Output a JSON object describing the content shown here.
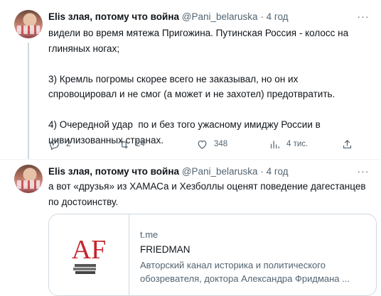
{
  "tweets": [
    {
      "author_name": "Elis злая, потому что война",
      "handle": "@Pani_belaruska",
      "separator": "·",
      "time": "4 год",
      "text": [
        "видели во время мятежа Пригожина. Путинская Россия - колосс на глиняных ногах;",
        "",
        "3) Кремль погромы скорее всего не заказывал, но он их спровоцировал и не смог (а может и не захотел) предотвратить.",
        "",
        "4) Очередной удар  по и без того ужасному имиджу России в цивилизованных странах."
      ],
      "actions": {
        "replies": "2",
        "retweets": "24",
        "likes": "348",
        "views": "4 тис."
      }
    },
    {
      "author_name": "Elis злая, потому что война",
      "handle": "@Pani_belaruska",
      "separator": "·",
      "time": "4 год",
      "text": [
        "а вот «друзья» из ХАМАСа и Хезболлы оценят поведение дагестанцев по достоинству."
      ],
      "card": {
        "domain": "t.me",
        "title": "FRIEDMAN",
        "description": "Авторский канал историка и политического обозревателя, доктора Александра Фридмана ...",
        "logo_text": "AF",
        "logo_color": "#c4252c"
      }
    }
  ],
  "icons": {
    "more": "more-horizontal-icon",
    "reply": "reply-icon",
    "retweet": "retweet-icon",
    "like": "heart-icon",
    "views": "views-chart-icon",
    "share": "share-icon"
  },
  "colors": {
    "text_primary": "#0f1419",
    "text_secondary": "#536471",
    "border": "#cfd9de"
  }
}
